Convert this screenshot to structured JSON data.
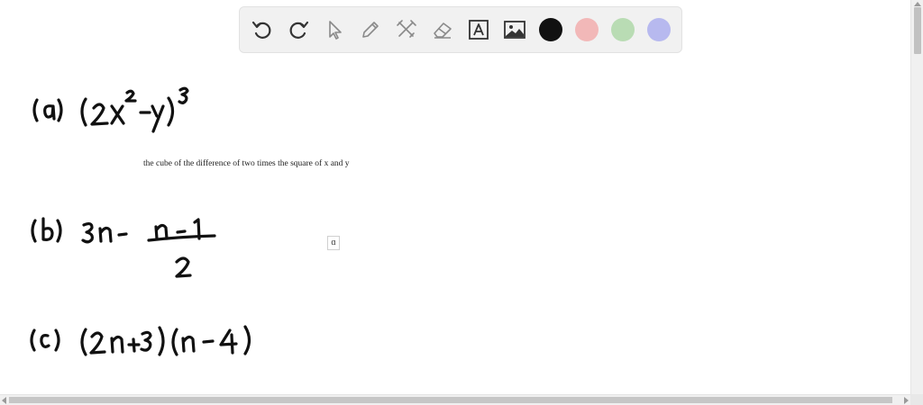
{
  "toolbar": {
    "tools": [
      {
        "name": "undo-button",
        "icon": "undo-icon"
      },
      {
        "name": "redo-button",
        "icon": "redo-icon"
      },
      {
        "name": "select-button",
        "icon": "pointer-icon"
      },
      {
        "name": "pen-button",
        "icon": "pen-icon"
      },
      {
        "name": "tools-button",
        "icon": "crossed-tools-icon"
      },
      {
        "name": "eraser-button",
        "icon": "eraser-icon"
      },
      {
        "name": "text-button",
        "icon": "text-box-icon"
      },
      {
        "name": "image-button",
        "icon": "image-icon"
      }
    ],
    "colors": {
      "black": "#111111",
      "red": "#f2b8b8",
      "green": "#b9dcb4",
      "blue": "#b7b9ef"
    }
  },
  "canvas": {
    "note_text": "the cube of  the difference of  two times the square of  x and y",
    "textbox_text": "ɑ",
    "ink_color": "#111111"
  }
}
